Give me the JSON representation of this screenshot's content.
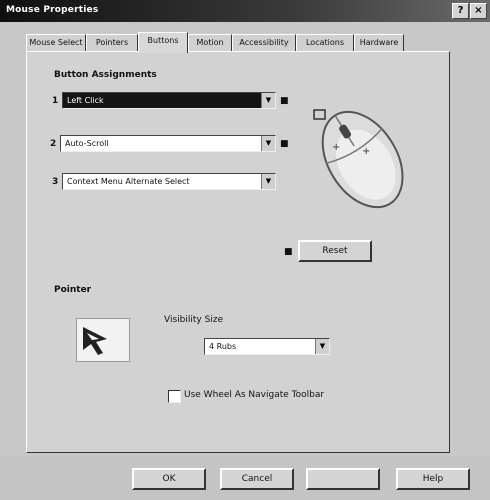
{
  "window": {
    "title": "Mouse Properties",
    "close_glyph": "×",
    "help_glyph": "?"
  },
  "tabs": [
    {
      "label": "Mouse Select"
    },
    {
      "label": "Pointers"
    },
    {
      "label": "Buttons"
    },
    {
      "label": "Motion"
    },
    {
      "label": "Accessibility"
    },
    {
      "label": "Locations"
    },
    {
      "label": "Hardware"
    }
  ],
  "buttons_group": {
    "label": "Button Assignments",
    "rows": [
      {
        "number": "1",
        "value": "Left Click"
      },
      {
        "number": "2",
        "value": "Auto-Scroll"
      },
      {
        "number": "3",
        "value": "Context Menu Alternate Select"
      }
    ],
    "reset_label": "Reset"
  },
  "pointer_group": {
    "label": "Pointer",
    "visibility_label": "Visibility Size",
    "size_value": "4 Rubs",
    "checkbox_label": "Use Wheel As Navigate Toolbar"
  },
  "footer": {
    "ok_label": "OK",
    "cancel_label": "Cancel",
    "apply_label": "",
    "help_label": "Help"
  }
}
